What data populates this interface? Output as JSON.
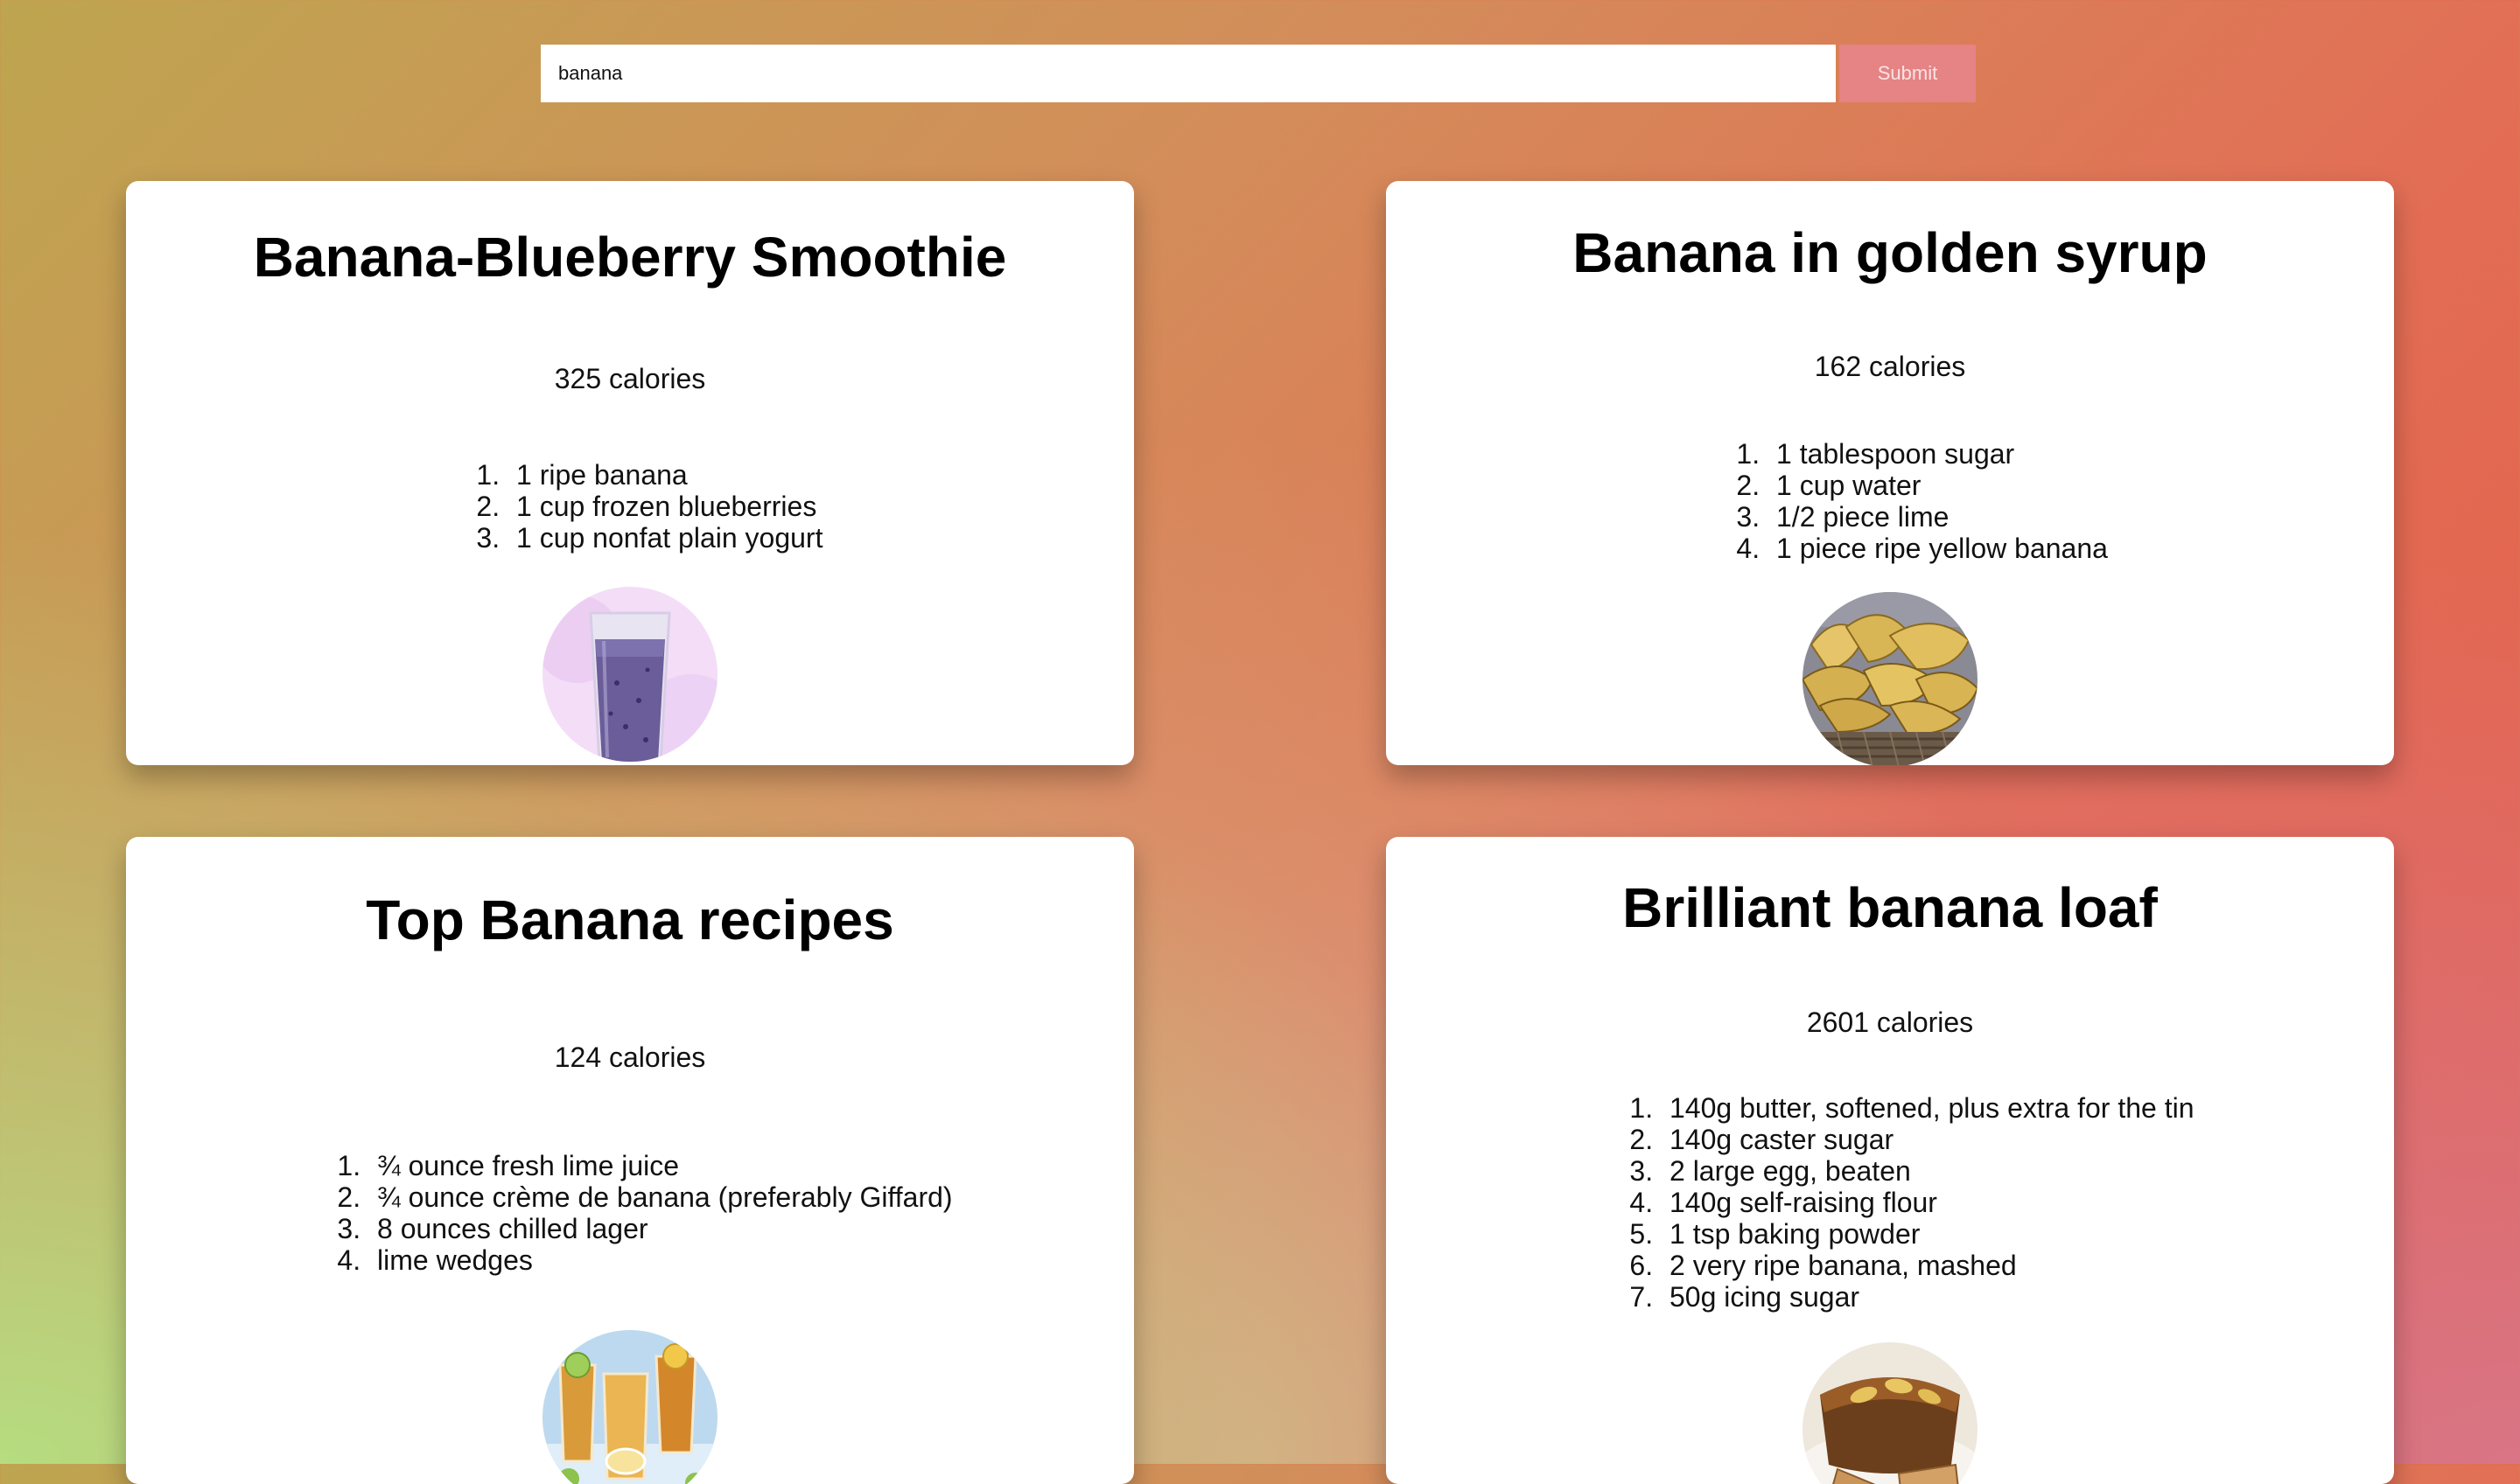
{
  "search": {
    "value": "banana",
    "submit_label": "Submit"
  },
  "recipes": [
    {
      "title": "Banana-Blueberry Smoothie",
      "calories": "325 calories",
      "ingredients": [
        "1 ripe banana",
        "1 cup frozen blueberries",
        "1 cup nonfat plain yogurt"
      ],
      "image_icon": "smoothie-photo"
    },
    {
      "title": "Banana in golden syrup",
      "calories": "162 calories",
      "ingredients": [
        "1 tablespoon sugar",
        "1 cup water",
        "1/2 piece lime",
        "1 piece ripe yellow banana"
      ],
      "image_icon": "bananas-basket-photo"
    },
    {
      "title": "Top Banana recipes",
      "calories": "124 calories",
      "ingredients": [
        "¾ ounce fresh lime juice",
        "¾ ounce crème de banana (preferably Giffard)",
        "8 ounces chilled lager",
        "lime wedges"
      ],
      "image_icon": "cocktails-photo"
    },
    {
      "title": "Brilliant banana loaf",
      "calories": "2601 calories",
      "ingredients": [
        "140g butter, softened, plus extra for the tin",
        "140g caster sugar",
        "2 large egg, beaten",
        "140g self-raising flour",
        "1 tsp baking powder",
        "2 very ripe banana, mashed",
        "50g icing sugar"
      ],
      "image_icon": "banana-loaf-photo"
    }
  ]
}
